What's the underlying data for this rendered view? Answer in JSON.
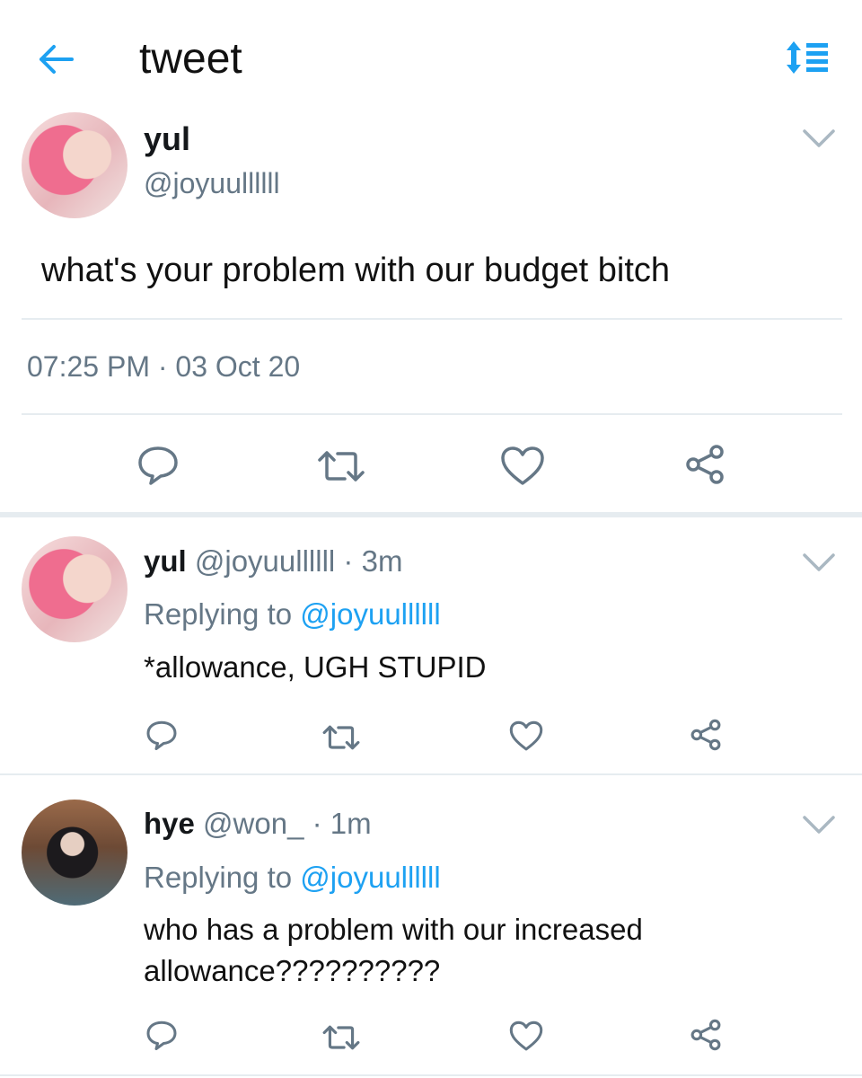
{
  "header": {
    "title": "tweet",
    "back_icon": "arrow-left-icon",
    "sort_icon": "sort-list-icon"
  },
  "colors": {
    "accent": "#1da1f2",
    "muted": "#657786",
    "divider": "#e6ecf0"
  },
  "main_tweet": {
    "display_name": "yul",
    "handle": "@joyuullllll",
    "text": "what's your problem with our budget bitch",
    "timestamp": "07:25 PM · 03 Oct 20"
  },
  "actions": [
    "reply-icon",
    "retweet-icon",
    "like-icon",
    "share-icon"
  ],
  "replies": [
    {
      "display_name": "yul",
      "handle": "@joyuullllll",
      "time": "3m",
      "replying_label": "Replying to",
      "replying_to": "@joyuullllll",
      "text": "*allowance, UGH STUPID"
    },
    {
      "display_name": "hye",
      "handle": "@won_",
      "time": "1m",
      "replying_label": "Replying to",
      "replying_to": "@joyuullllll",
      "text_line1": "who has a problem with our increased",
      "text_line2": "allowance??????????"
    }
  ]
}
